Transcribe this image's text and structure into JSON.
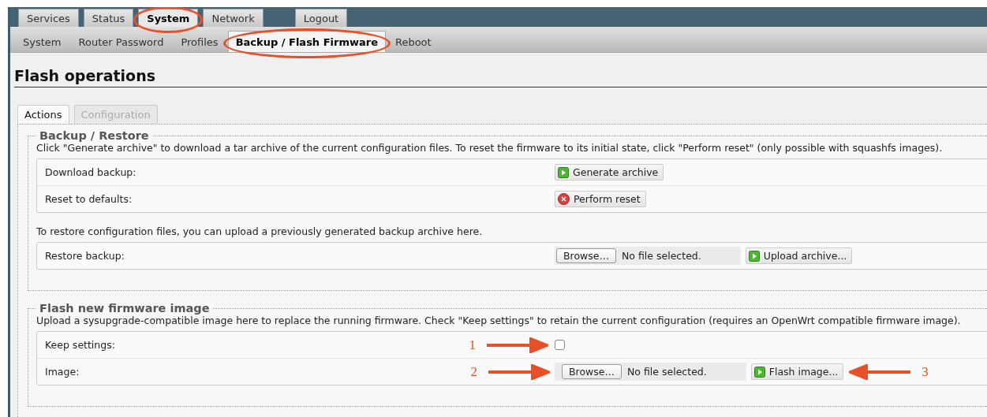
{
  "main_tabs": [
    {
      "label": "Services",
      "selected": false,
      "circled": false
    },
    {
      "label": "Status",
      "selected": false,
      "circled": false
    },
    {
      "label": "System",
      "selected": true,
      "circled": true
    },
    {
      "label": "Network",
      "selected": false,
      "circled": false
    },
    {
      "label": "Logout",
      "selected": false,
      "circled": false,
      "kind": "spaced"
    }
  ],
  "sub_tabs": [
    {
      "label": "System",
      "selected": false,
      "circled": false
    },
    {
      "label": "Router Password",
      "selected": false,
      "circled": false
    },
    {
      "label": "Profiles",
      "selected": false,
      "circled": false
    },
    {
      "label": "Backup / Flash Firmware",
      "selected": true,
      "circled": true
    },
    {
      "label": "Reboot",
      "selected": false,
      "circled": false
    }
  ],
  "title": "Flash operations",
  "section_tabs": [
    {
      "label": "Actions",
      "selected": true,
      "disabled": false
    },
    {
      "label": "Configuration",
      "selected": false,
      "disabled": true
    }
  ],
  "fieldsets": [
    {
      "legend": "Backup / Restore",
      "blocks": [
        {
          "description": "Click \"Generate archive\" to download a tar archive of the current configuration files. To reset the firmware to its initial state, click \"Perform reset\" (only possible with squashfs images).",
          "rows": [
            {
              "label": "Download backup:",
              "controls": [
                {
                  "kind": "action",
                  "label": "Generate archive"
                }
              ]
            },
            {
              "label": "Reset to defaults:",
              "controls": [
                {
                  "kind": "reset",
                  "label": "Perform reset"
                }
              ]
            }
          ]
        },
        {
          "description": "To restore configuration files, you can upload a previously generated backup archive here.",
          "rows": [
            {
              "label": "Restore backup:",
              "controls": [
                {
                  "kind": "file",
                  "button": "Browse…",
                  "value": "No file selected."
                },
                {
                  "kind": "action",
                  "label": "Upload archive..."
                }
              ]
            }
          ]
        }
      ]
    },
    {
      "legend": "Flash new firmware image",
      "blocks": [
        {
          "description": "Upload a sysupgrade-compatible image here to replace the running firmware. Check \"Keep settings\" to retain the current configuration (requires an OpenWrt compatible firmware image).",
          "rows": [
            {
              "label": "Keep settings:",
              "callout": "1",
              "controls": [
                {
                  "kind": "checkbox",
                  "checked": false
                }
              ]
            },
            {
              "label": "Image:",
              "callout": "2",
              "controls": [
                {
                  "kind": "file",
                  "button": "Browse…",
                  "value": "No file selected."
                },
                {
                  "kind": "action",
                  "label": "Flash image...",
                  "callout": "3"
                }
              ]
            }
          ]
        }
      ]
    }
  ]
}
